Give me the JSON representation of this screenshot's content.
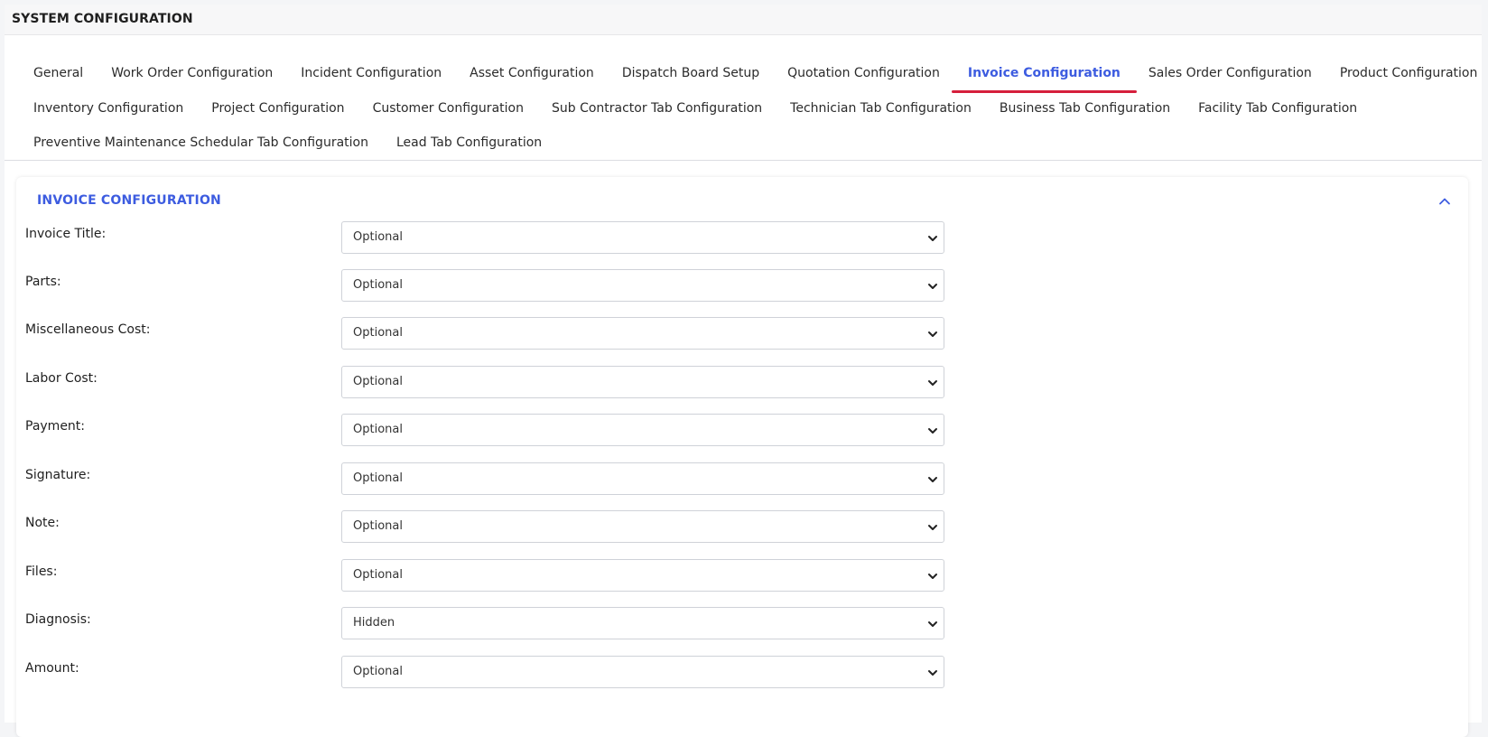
{
  "header": {
    "title": "SYSTEM CONFIGURATION"
  },
  "tabs": {
    "row1": [
      "General",
      "Work Order Configuration",
      "Incident Configuration",
      "Asset Configuration",
      "Dispatch Board Setup",
      "Quotation Configuration",
      "Invoice Configuration",
      "Sales Order Configuration",
      "Product Configuration"
    ],
    "row2": [
      "Inventory Configuration",
      "Project Configuration",
      "Customer Configuration",
      "Sub Contractor Tab Configuration",
      "Technician Tab Configuration",
      "Business Tab Configuration",
      "Facility Tab Configuration"
    ],
    "row3": [
      "Preventive Maintenance Schedular Tab Configuration",
      "Lead Tab Configuration"
    ],
    "active": "Invoice Configuration"
  },
  "panel": {
    "title": "INVOICE CONFIGURATION",
    "fields": [
      {
        "label": "Invoice Title:",
        "value": "Optional"
      },
      {
        "label": "Parts:",
        "value": "Optional"
      },
      {
        "label": "Miscellaneous Cost:",
        "value": "Optional"
      },
      {
        "label": "Labor Cost:",
        "value": "Optional"
      },
      {
        "label": "Payment:",
        "value": "Optional"
      },
      {
        "label": "Signature:",
        "value": "Optional"
      },
      {
        "label": "Note:",
        "value": "Optional"
      },
      {
        "label": "Files:",
        "value": "Optional"
      },
      {
        "label": "Diagnosis:",
        "value": "Hidden"
      },
      {
        "label": "Amount:",
        "value": "Optional"
      }
    ]
  },
  "colors": {
    "accent": "#3d5ce0",
    "active_underline": "#d61f3c"
  },
  "icons": {
    "collapse": "chevron-up-icon",
    "select": "chevron-down-icon"
  }
}
